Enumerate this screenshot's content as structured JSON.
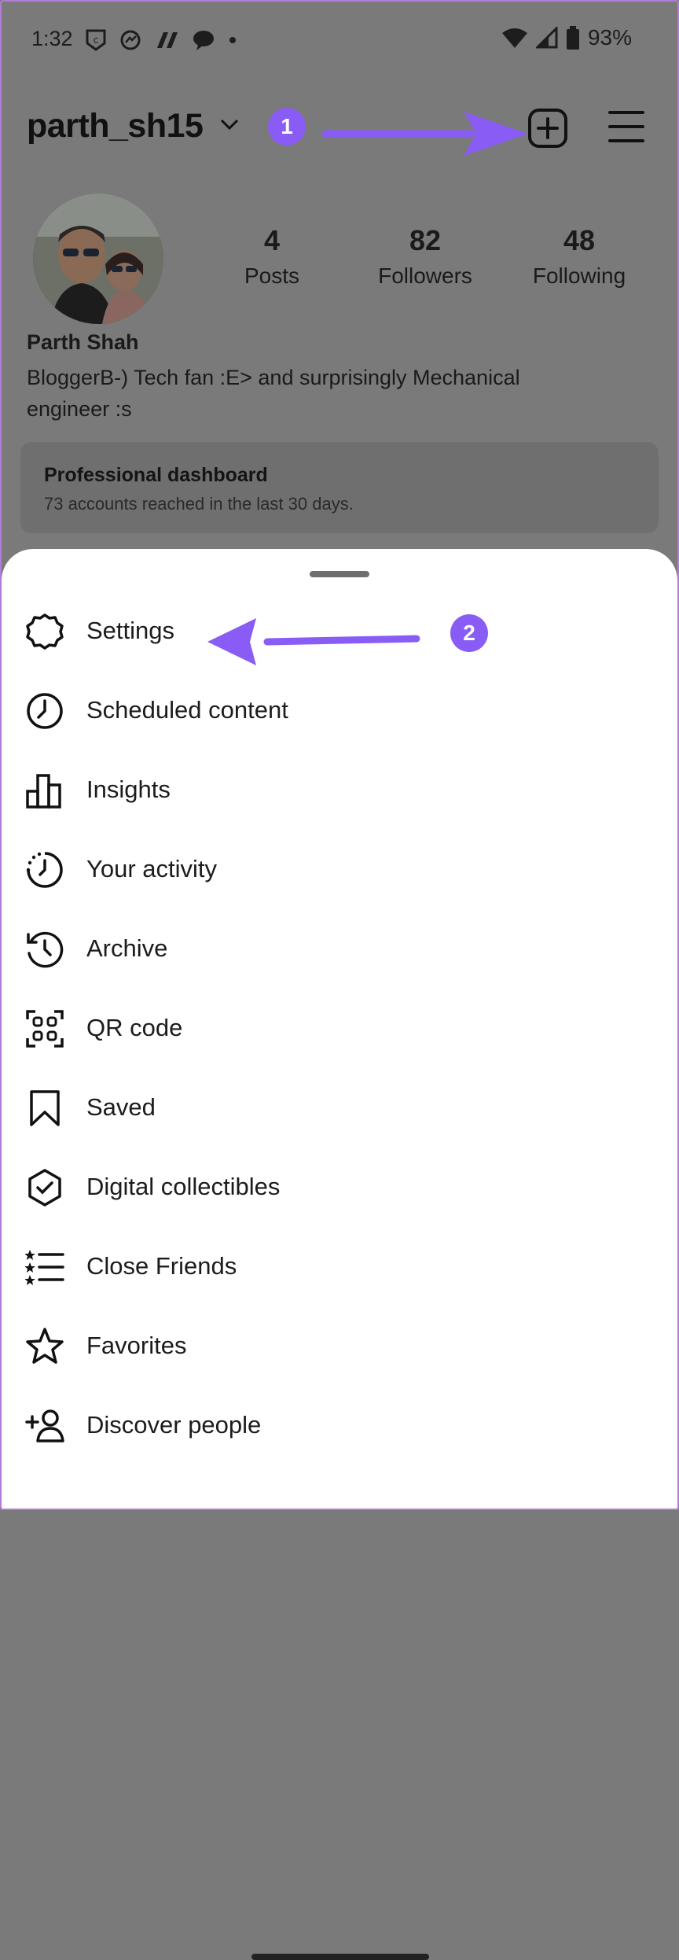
{
  "status_bar": {
    "time": "1:32",
    "battery": "93%"
  },
  "header": {
    "username": "parth_sh15"
  },
  "annotations": {
    "step1": "1",
    "step2": "2",
    "accent_color": "#8a5cf6"
  },
  "profile": {
    "stats": [
      {
        "value": "4",
        "label": "Posts"
      },
      {
        "value": "82",
        "label": "Followers"
      },
      {
        "value": "48",
        "label": "Following"
      }
    ],
    "full_name": "Parth Shah",
    "bio": "BloggerB-) Tech fan :E> and surprisingly Mechanical engineer :s",
    "dashboard": {
      "title": "Professional dashboard",
      "subtitle": "73 accounts reached in the last 30 days."
    }
  },
  "menu": {
    "items": [
      {
        "label": "Settings",
        "icon": "gear-icon"
      },
      {
        "label": "Scheduled content",
        "icon": "clock-icon"
      },
      {
        "label": "Insights",
        "icon": "bar-chart-icon"
      },
      {
        "label": "Your activity",
        "icon": "activity-icon"
      },
      {
        "label": "Archive",
        "icon": "archive-history-icon"
      },
      {
        "label": "QR code",
        "icon": "qr-code-icon"
      },
      {
        "label": "Saved",
        "icon": "bookmark-icon"
      },
      {
        "label": "Digital collectibles",
        "icon": "verified-badge-icon"
      },
      {
        "label": "Close Friends",
        "icon": "star-list-icon"
      },
      {
        "label": "Favorites",
        "icon": "star-icon"
      },
      {
        "label": "Discover people",
        "icon": "add-person-icon"
      }
    ]
  }
}
